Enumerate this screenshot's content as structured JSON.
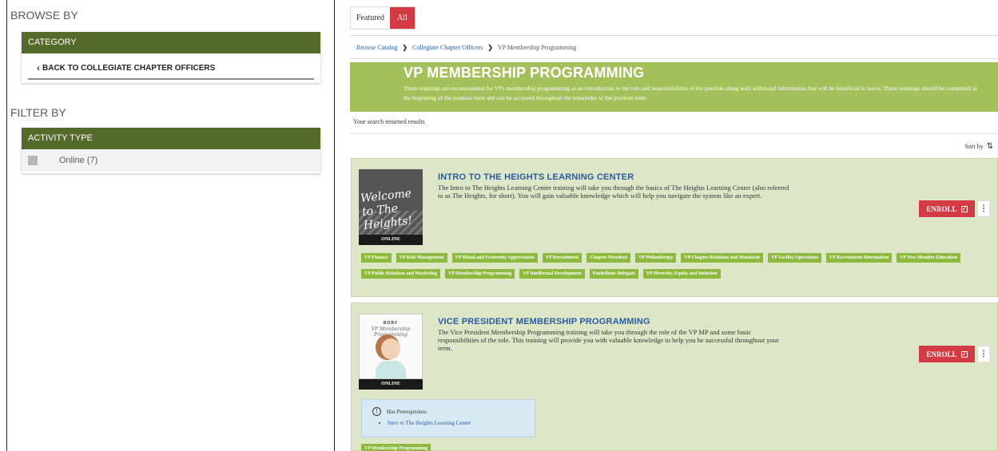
{
  "sidebar": {
    "browse_title": "BROWSE BY",
    "category_header": "CATEGORY",
    "back_link": "BACK TO COLLEGIATE CHAPTER OFFICERS",
    "filter_title": "FILTER BY",
    "activity_header": "ACTIVITY TYPE",
    "activity_option": "Online (7)"
  },
  "tabs": {
    "featured": "Featured",
    "all": "All"
  },
  "breadcrumb": {
    "items": [
      "Browse Catalog",
      "Collegiate Chapter Officers",
      "VP Membership Programming"
    ]
  },
  "hero": {
    "title": "VP MEMBERSHIP PROGRAMMING",
    "description": "These trainings are recommended for VPs membership programming as an introduction to the role and responsibilities of the position along with additional information that will be beneficial to know. These trainings should be completed at the beginning of the position term and can be accessed throughout the remainder of the position term."
  },
  "results_text": "Your search returned results",
  "sort_label": "Sort by",
  "cards": [
    {
      "title": "INTRO TO THE HEIGHTS LEARNING CENTER",
      "description": "The Intro to The Heights Learning Center training will take you through the basics of The Heights Learning Center (also referred to as The Heights, for short). You will gain valuable knowledge which will help you navigate the system like an expert.",
      "thumb_text": "Welcome to The Heights!",
      "type_tag": "ONLINE",
      "enroll": "ENROLL",
      "tags": [
        "VP Finance",
        "VP Risk Management",
        "VP Ritual and Fraternity Appreciation",
        "VP Recruitment",
        "Chapter President",
        "VP Philanthropy",
        "VP Chapter Relations and Standards",
        "VP Facility Operations",
        "VP Recruitment Information",
        "VP New Member Education",
        "VP Public Relations and Marketing",
        "VP Membership Programming",
        "VP Intellectual Development",
        "Panhellenic Delegate",
        "VP Diversity, Equity and Inclusion"
      ]
    },
    {
      "title": "VICE PRESIDENT MEMBERSHIP PROGRAMMING",
      "description": "The Vice President Membership Programming training will take you through the role of the VP MP and some basic responsibilities of the role. This training will provide you with valuable knowledge to help you be successful throughout your term.",
      "thumb_top": "RORY",
      "thumb_sub": "VP Membership Programming",
      "type_tag": "ONLINE",
      "enroll": "ENROLL",
      "prereq_label": "Has Prerequisites:",
      "prereq_item": "Intro to The Heights Learning Center",
      "tags": [
        "VP Membership Programming"
      ]
    }
  ],
  "colors": {
    "sidebar_header": "#566a2c",
    "hero": "#a4c05a",
    "card_bg": "#dde6c7",
    "accent_red": "#d43a44",
    "chip": "#8db93e",
    "link": "#2a5b9e"
  }
}
